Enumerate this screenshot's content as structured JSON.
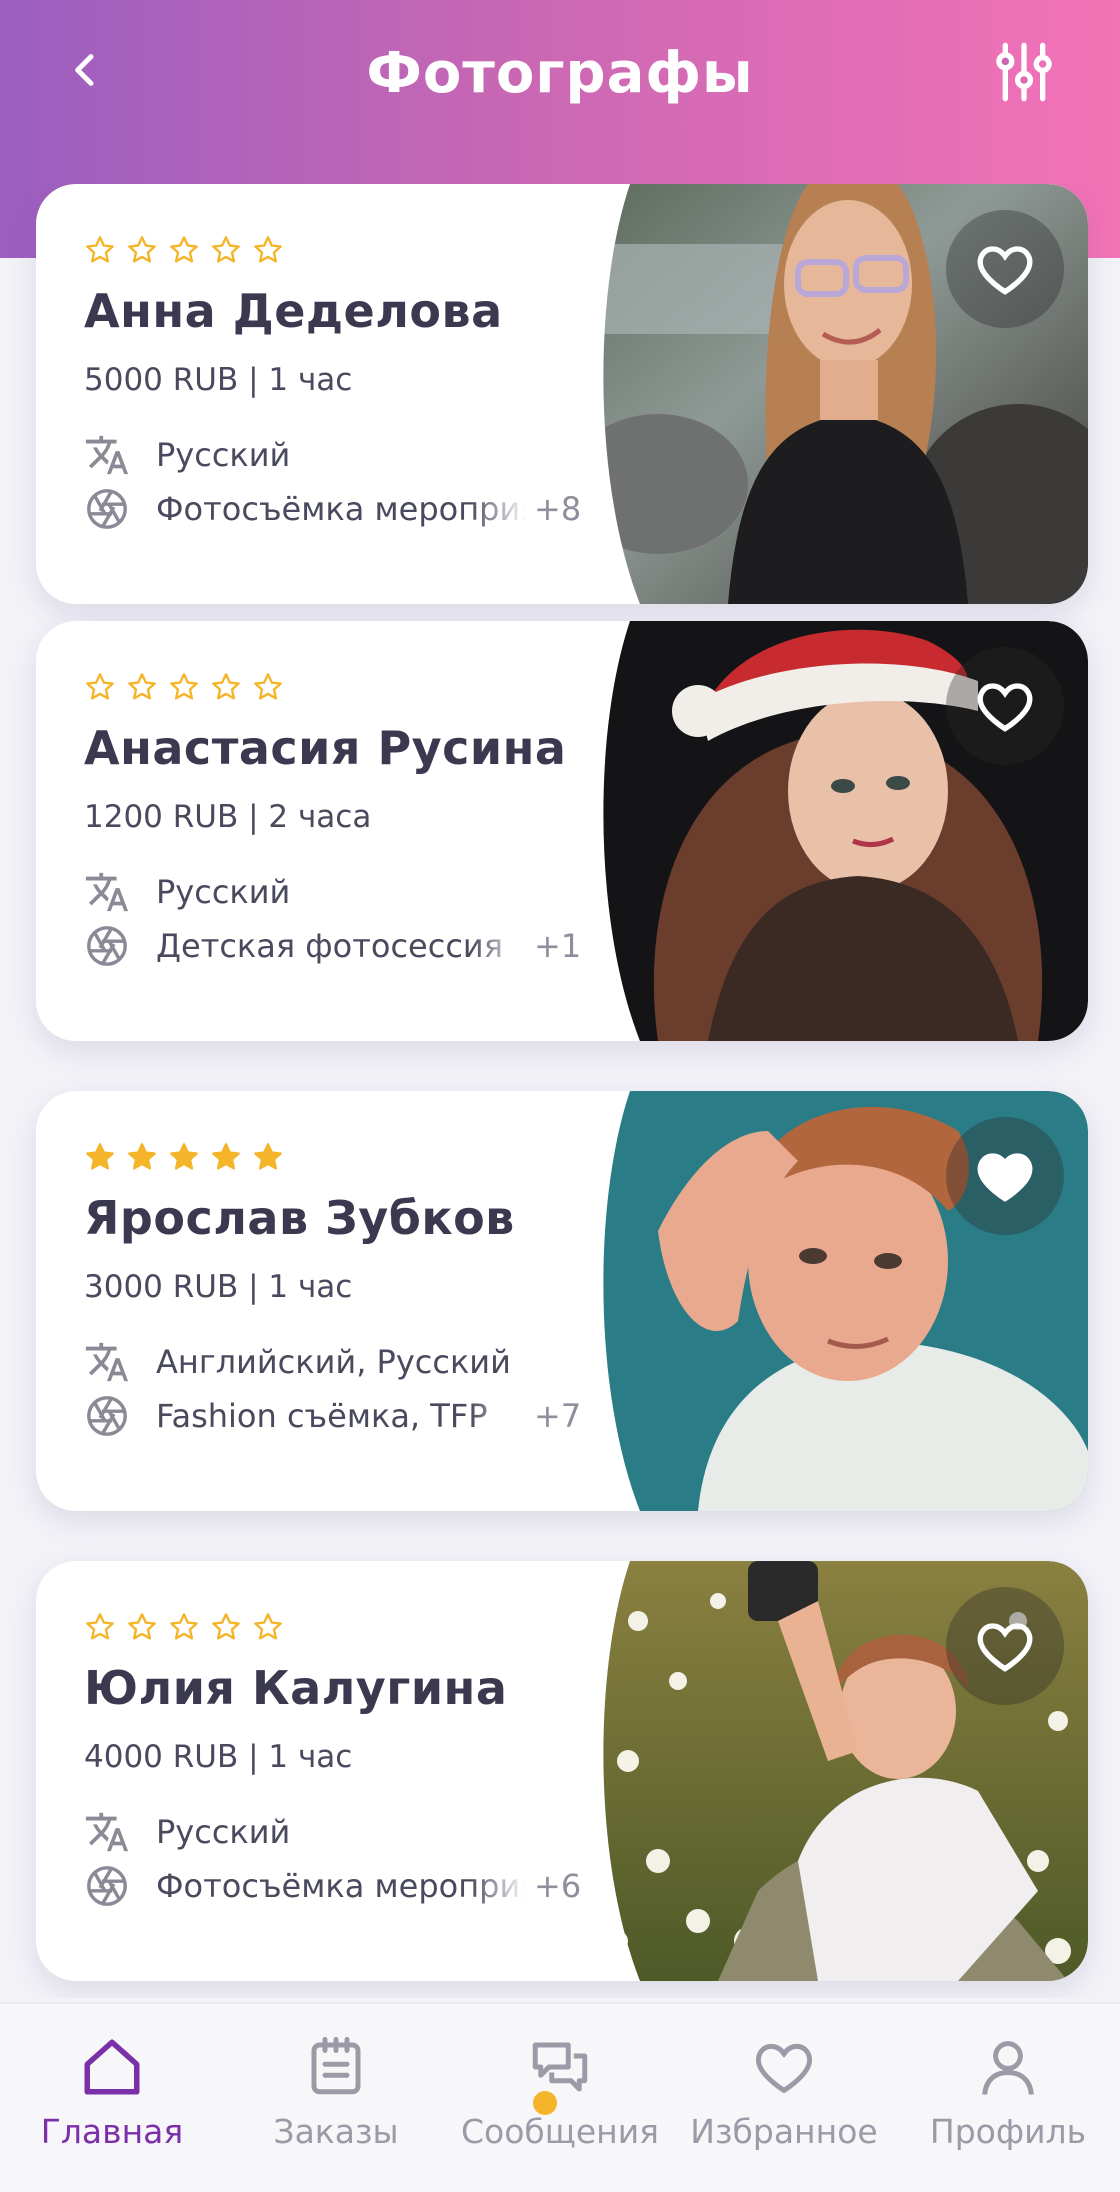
{
  "header": {
    "title": "Фотографы"
  },
  "cards": [
    {
      "name": "Анна Деделова",
      "price": "5000 RUB | 1 час",
      "languages": "Русский",
      "specialty": "Фотосъёмка мероприятий",
      "more": "+8",
      "rating": 0,
      "favorite": false
    },
    {
      "name": "Анастасия Русина",
      "price": "1200 RUB | 2 часа",
      "languages": "Русский",
      "specialty": "Детская фотосессия",
      "more": "+1",
      "rating": 0,
      "favorite": false
    },
    {
      "name": "Ярослав Зубков",
      "price": "3000 RUB | 1 час",
      "languages": "Английский, Русский",
      "specialty": "Fashion съёмка, TFP",
      "more": "+7",
      "rating": 5,
      "favorite": true
    },
    {
      "name": "Юлия  Калугина",
      "price": "4000 RUB | 1 час",
      "languages": "Русский",
      "specialty": "Фотосъёмка мероприятий",
      "more": "+6",
      "rating": 0,
      "favorite": false
    }
  ],
  "tabs": [
    {
      "label": "Главная",
      "icon": "home-icon",
      "active": true
    },
    {
      "label": "Заказы",
      "icon": "orders-icon",
      "active": false
    },
    {
      "label": "Сообщения",
      "icon": "messages-icon",
      "active": false,
      "badge": true
    },
    {
      "label": "Избранное",
      "icon": "heart-icon",
      "active": false
    },
    {
      "label": "Профиль",
      "icon": "profile-icon",
      "active": false
    }
  ],
  "colors": {
    "accent": "#7b2fa8",
    "star": "#f5b52a",
    "header_start": "#9b5fc0",
    "header_end": "#f472b6",
    "badge": "#f5b52a"
  }
}
